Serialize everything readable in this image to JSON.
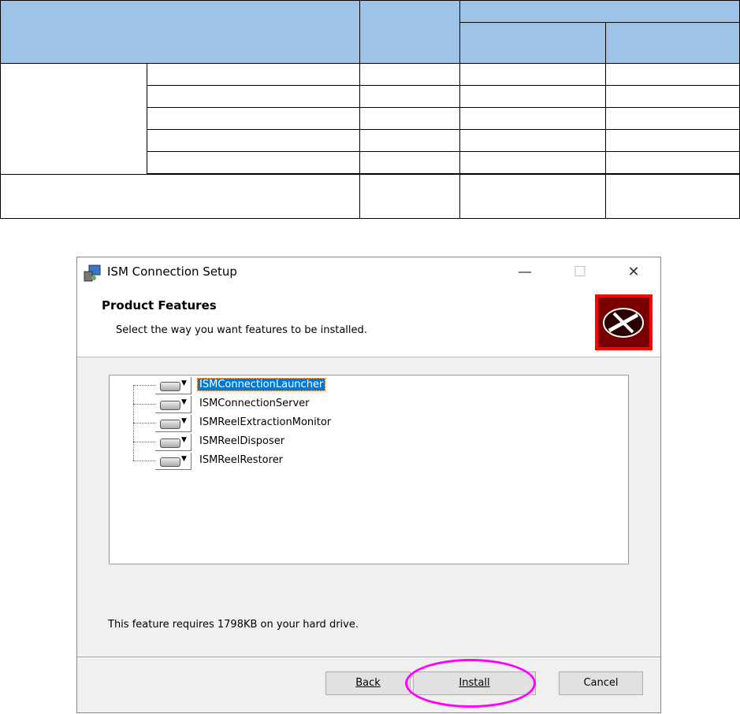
{
  "table": {
    "header_color": "#9dc3e6"
  },
  "dialog": {
    "title": "ISM Connection Setup",
    "window_controls": {
      "minimize": "—",
      "maximize": "☐",
      "close": "✕"
    },
    "header": {
      "title": "Product Features",
      "subtitle": "Select the way you want features to be installed."
    },
    "features": [
      {
        "label": "ISMConnectionLauncher",
        "selected": true
      },
      {
        "label": "ISMConnectionServer",
        "selected": false
      },
      {
        "label": "ISMReelExtractionMonitor",
        "selected": false
      },
      {
        "label": "ISMReelDisposer",
        "selected": false
      },
      {
        "label": "ISMReelRestorer",
        "selected": false
      }
    ],
    "status": "This feature requires 1798KB on your hard drive.",
    "buttons": {
      "back": "Back",
      "install": "Install",
      "cancel": "Cancel"
    },
    "highlight_color": "#ff00ff"
  }
}
